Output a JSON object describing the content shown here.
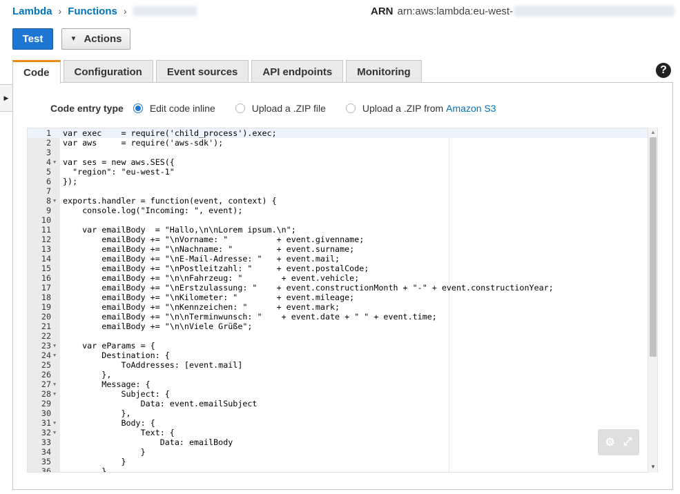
{
  "breadcrumb": {
    "lambda": "Lambda",
    "functions": "Functions",
    "separator": "›"
  },
  "arn": {
    "label": "ARN",
    "value": "arn:aws:lambda:eu-west-"
  },
  "toolbar": {
    "test_label": "Test",
    "actions_label": "Actions",
    "actions_icon": "▼"
  },
  "tabs": [
    {
      "label": "Code",
      "active": true
    },
    {
      "label": "Configuration"
    },
    {
      "label": "Event sources"
    },
    {
      "label": "API endpoints"
    },
    {
      "label": "Monitoring"
    }
  ],
  "help_icon": "?",
  "side_toggle_icon": "▶",
  "code_entry": {
    "label": "Code entry type",
    "options": [
      {
        "label": "Edit code inline",
        "selected": true
      },
      {
        "label": "Upload a .ZIP file",
        "selected": false
      },
      {
        "label": "Upload a .ZIP from",
        "link": "Amazon S3",
        "selected": false
      }
    ]
  },
  "editor": {
    "settings_icon": "⚙",
    "fullscreen_icon": "⤢",
    "lines": [
      {
        "n": "1",
        "code": "var exec    = require('child_process').exec;"
      },
      {
        "n": "2",
        "code": "var aws     = require('aws-sdk');"
      },
      {
        "n": "3",
        "code": ""
      },
      {
        "n": "4",
        "fold": true,
        "code": "var ses = new aws.SES({"
      },
      {
        "n": "5",
        "code": "  \"region\": \"eu-west-1\""
      },
      {
        "n": "6",
        "code": "});"
      },
      {
        "n": "7",
        "code": ""
      },
      {
        "n": "8",
        "fold": true,
        "code": "exports.handler = function(event, context) {"
      },
      {
        "n": "9",
        "code": "    console.log(\"Incoming: \", event);"
      },
      {
        "n": "10",
        "code": ""
      },
      {
        "n": "11",
        "code": "    var emailBody  = \"Hallo,\\n\\nLorem ipsum.\\n\";"
      },
      {
        "n": "12",
        "code": "        emailBody += \"\\nVorname: \"          + event.givenname;"
      },
      {
        "n": "13",
        "code": "        emailBody += \"\\nNachname: \"         + event.surname;"
      },
      {
        "n": "14",
        "code": "        emailBody += \"\\nE-Mail-Adresse: \"   + event.mail;"
      },
      {
        "n": "15",
        "code": "        emailBody += \"\\nPostleitzahl: \"     + event.postalCode;"
      },
      {
        "n": "16",
        "code": "        emailBody += \"\\n\\nFahrzeug: \"        + event.vehicle;"
      },
      {
        "n": "17",
        "code": "        emailBody += \"\\nErstzulassung: \"    + event.constructionMonth + \"-\" + event.constructionYear;"
      },
      {
        "n": "18",
        "code": "        emailBody += \"\\nKilometer: \"        + event.mileage;"
      },
      {
        "n": "19",
        "code": "        emailBody += \"\\nKennzeichen: \"      + event.mark;"
      },
      {
        "n": "20",
        "code": "        emailBody += \"\\n\\nTerminwunsch: \"    + event.date + \" \" + event.time;"
      },
      {
        "n": "21",
        "code": "        emailBody += \"\\n\\nViele Grüße\";"
      },
      {
        "n": "22",
        "code": ""
      },
      {
        "n": "23",
        "fold": true,
        "code": "    var eParams = {"
      },
      {
        "n": "24",
        "fold": true,
        "code": "        Destination: {"
      },
      {
        "n": "25",
        "code": "            ToAddresses: [event.mail]"
      },
      {
        "n": "26",
        "code": "        },"
      },
      {
        "n": "27",
        "fold": true,
        "code": "        Message: {"
      },
      {
        "n": "28",
        "fold": true,
        "code": "            Subject: {"
      },
      {
        "n": "29",
        "code": "                Data: event.emailSubject"
      },
      {
        "n": "30",
        "code": "            },"
      },
      {
        "n": "31",
        "fold": true,
        "code": "            Body: {"
      },
      {
        "n": "32",
        "fold": true,
        "code": "                Text: {"
      },
      {
        "n": "33",
        "code": "                    Data: emailBody"
      },
      {
        "n": "34",
        "code": "                }"
      },
      {
        "n": "35",
        "code": "            }"
      },
      {
        "n": "36",
        "code": "        }"
      }
    ]
  }
}
